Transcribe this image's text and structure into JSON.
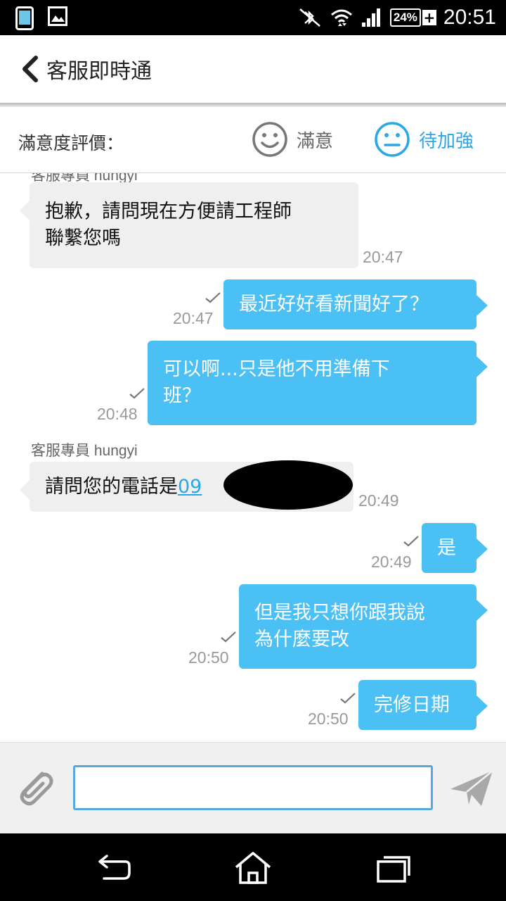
{
  "status_bar": {
    "time": "20:51",
    "battery": "24%"
  },
  "header": {
    "title": "客服即時通"
  },
  "rating": {
    "label": "滿意度評價：",
    "satisfied_label": "滿意",
    "improve_label": "待加強",
    "accent_color": "#2aa7e8"
  },
  "messages": [
    {
      "dir": "in",
      "sender": "客服專員 hungyi",
      "text_lines": [
        "抱歉，請問現在方便請工程師",
        "聯繫您嗎"
      ],
      "time": "20:47"
    },
    {
      "dir": "out",
      "text_lines": [
        "最近好好看新聞好了？"
      ],
      "time": "20:47"
    },
    {
      "dir": "out",
      "text_lines": [
        "可以啊...只是他不用準備下",
        "班？"
      ],
      "time": "20:48"
    },
    {
      "dir": "in",
      "sender": "客服專員 hungyi",
      "text_prefix": "請問您的電話是",
      "link_text": "09",
      "time": "20:49"
    },
    {
      "dir": "out",
      "text_lines": [
        "是"
      ],
      "time": "20:49"
    },
    {
      "dir": "out",
      "text_lines": [
        "但是我只想你跟我說",
        "為什麼要改"
      ],
      "time": "20:50"
    },
    {
      "dir": "out",
      "text_lines": [
        "完修日期"
      ],
      "time": "20:50"
    }
  ],
  "colors": {
    "outgoing_bubble": "#4bc0f4",
    "incoming_bubble": "#efefef",
    "input_border": "#58a8e0"
  },
  "composer": {
    "input_value": ""
  }
}
